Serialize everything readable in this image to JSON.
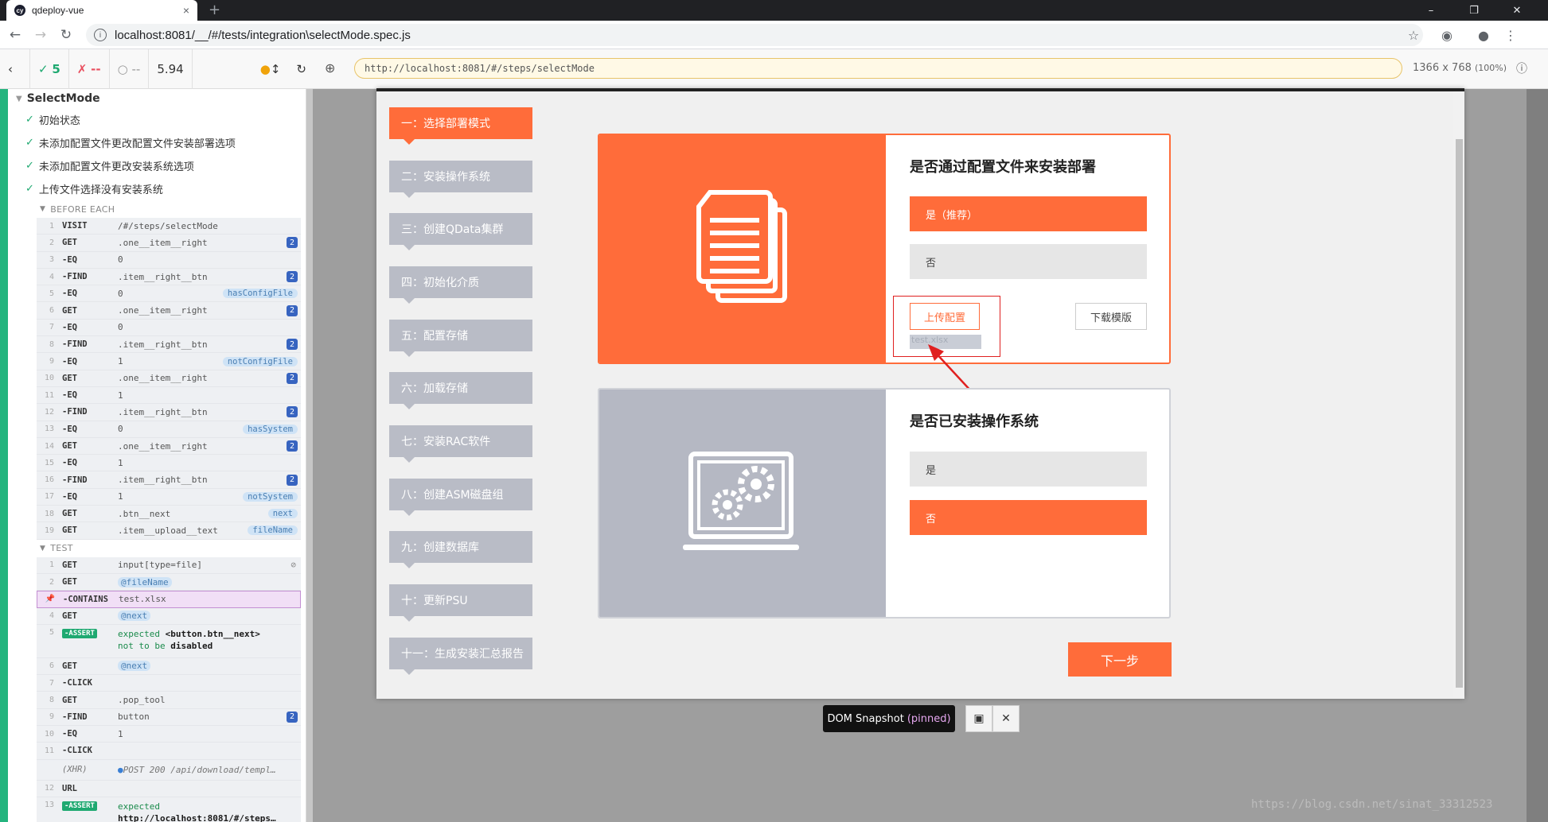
{
  "browser": {
    "tab_title": "qdeploy-vue",
    "tab_close": "×",
    "new_tab": "+",
    "address": "localhost:8081/__/#/tests/integration\\selectMode.spec.js",
    "win_min": "–",
    "win_max": "❐",
    "win_close": "✕"
  },
  "cypress": {
    "passed": "5",
    "failed": "--",
    "pending": "--",
    "duration": "5.94",
    "aut_url": "http://localhost:8081/#/steps/selectMode",
    "viewport": "1366 x 768",
    "zoom": "(100%)"
  },
  "reporter": {
    "suite": "SelectMode",
    "tests": [
      "初始状态",
      "未添加配置文件更改配置文件安装部署选项",
      "未添加配置文件更改安装系统选项",
      "上传文件选择没有安装系统"
    ],
    "before_each_label": "BEFORE EACH",
    "test_label": "TEST",
    "before_each": [
      {
        "n": "1",
        "name": "VISIT",
        "msg": "/#/steps/selectMode",
        "count": "",
        "alias": ""
      },
      {
        "n": "2",
        "name": "GET",
        "msg": ".one__item__right",
        "count": "2",
        "alias": ""
      },
      {
        "n": "3",
        "name": "-EQ",
        "msg": "0",
        "count": "",
        "alias": ""
      },
      {
        "n": "4",
        "name": "-FIND",
        "msg": ".item__right__btn",
        "count": "2",
        "alias": ""
      },
      {
        "n": "5",
        "name": "-EQ",
        "msg": "0",
        "count": "",
        "alias": "hasConfigFile"
      },
      {
        "n": "6",
        "name": "GET",
        "msg": ".one__item__right",
        "count": "2",
        "alias": ""
      },
      {
        "n": "7",
        "name": "-EQ",
        "msg": "0",
        "count": "",
        "alias": ""
      },
      {
        "n": "8",
        "name": "-FIND",
        "msg": ".item__right__btn",
        "count": "2",
        "alias": ""
      },
      {
        "n": "9",
        "name": "-EQ",
        "msg": "1",
        "count": "",
        "alias": "notConfigFile"
      },
      {
        "n": "10",
        "name": "GET",
        "msg": ".one__item__right",
        "count": "2",
        "alias": ""
      },
      {
        "n": "11",
        "name": "-EQ",
        "msg": "1",
        "count": "",
        "alias": ""
      },
      {
        "n": "12",
        "name": "-FIND",
        "msg": ".item__right__btn",
        "count": "2",
        "alias": ""
      },
      {
        "n": "13",
        "name": "-EQ",
        "msg": "0",
        "count": "",
        "alias": "hasSystem"
      },
      {
        "n": "14",
        "name": "GET",
        "msg": ".one__item__right",
        "count": "2",
        "alias": ""
      },
      {
        "n": "15",
        "name": "-EQ",
        "msg": "1",
        "count": "",
        "alias": ""
      },
      {
        "n": "16",
        "name": "-FIND",
        "msg": ".item__right__btn",
        "count": "2",
        "alias": ""
      },
      {
        "n": "17",
        "name": "-EQ",
        "msg": "1",
        "count": "",
        "alias": "notSystem"
      },
      {
        "n": "18",
        "name": "GET",
        "msg": ".btn__next",
        "count": "",
        "alias": "next"
      },
      {
        "n": "19",
        "name": "GET",
        "msg": ".item__upload__text",
        "count": "",
        "alias": "fileName"
      }
    ],
    "test_cmds": {
      "c1": {
        "n": "1",
        "name": "GET",
        "msg": "input[type=file]"
      },
      "c2": {
        "n": "2",
        "name": "GET",
        "msg": "@fileName"
      },
      "c3": {
        "n": "",
        "name": "-CONTAINS",
        "msg": "test.xlsx"
      },
      "c4": {
        "n": "4",
        "name": "GET",
        "msg": "@next"
      },
      "c5": {
        "n": "5",
        "name": "-ASSERT",
        "l1a": "expected",
        "l1b": "<button.btn__next>",
        "l2a": "not to be",
        "l2b": "disabled"
      },
      "c6": {
        "n": "6",
        "name": "GET",
        "msg": "@next"
      },
      "c7": {
        "n": "7",
        "name": "-CLICK",
        "msg": ""
      },
      "c8": {
        "n": "8",
        "name": "GET",
        "msg": ".pop_tool"
      },
      "c9": {
        "n": "9",
        "name": "-FIND",
        "msg": "button",
        "count": "2"
      },
      "c10": {
        "n": "10",
        "name": "-EQ",
        "msg": "1"
      },
      "c11": {
        "n": "11",
        "name": "-CLICK",
        "msg": ""
      },
      "xhr": {
        "n": "",
        "name": "(XHR)",
        "msg": "POST 200 /api/download/templ…"
      },
      "c12": {
        "n": "12",
        "name": "URL",
        "msg": ""
      },
      "c13": {
        "n": "13",
        "name": "-ASSERT",
        "l1a": "expected",
        "l2b": "http://localhost:8081/#/steps…"
      }
    }
  },
  "app": {
    "steps": [
      "一：选择部署模式",
      "二：安装操作系统",
      "三：创建QData集群",
      "四：初始化介质",
      "五：配置存储",
      "六：加载存储",
      "七：安装RAC软件",
      "八：创建ASM磁盘组",
      "九：创建数据库",
      "十：更新PSU",
      "十一：生成安装汇总报告"
    ],
    "card1": {
      "title": "是否通过配置文件来安装部署",
      "opt_yes": "是（推荐）",
      "opt_no": "否",
      "upload": "上传配置",
      "download": "下载模版",
      "file_name": "test.xlsx"
    },
    "card2": {
      "title": "是否已安装操作系统",
      "opt_yes": "是",
      "opt_no": "否"
    },
    "next": "下一步"
  },
  "snapshot": {
    "label": "DOM Snapshot",
    "pinned": "(pinned)"
  },
  "watermark": "https://blog.csdn.net/sinat_33312523",
  "colors": {
    "accent": "#ff6c3a",
    "pass": "#1fa971",
    "panel_gray": "#b5b8c3"
  }
}
